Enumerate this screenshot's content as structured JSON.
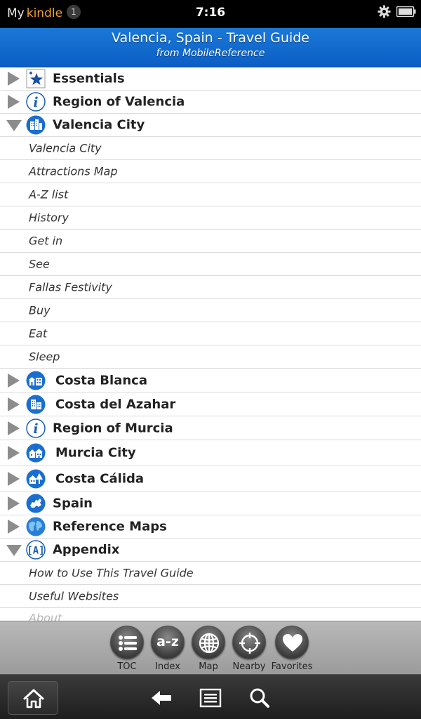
{
  "status_bar": {
    "brand_my": "My",
    "brand_kindle": "kindle",
    "notification_count": "1",
    "clock": "7:16",
    "settings_icon": "gear-icon",
    "battery_icon": "battery-icon"
  },
  "header": {
    "title": "Valencia, Spain - Travel Guide",
    "subtitle": "from MobileReference",
    "color": "#0b5ec4"
  },
  "toc": {
    "sections": [
      {
        "label": "Essentials",
        "icon": "star-icon",
        "expanded": false
      },
      {
        "label": "Region of Valencia",
        "icon": "info-icon",
        "expanded": false
      },
      {
        "label": "Valencia City",
        "icon": "city-icon",
        "expanded": true,
        "items": [
          "Valencia City",
          "Attractions Map",
          "A-Z list",
          "History",
          "Get in",
          "See",
          "Fallas Festivity",
          "Buy",
          "Eat",
          "Sleep"
        ]
      },
      {
        "label": "Costa Blanca",
        "icon": "town-icon",
        "expanded": false
      },
      {
        "label": "Costa del Azahar",
        "icon": "buildings-icon",
        "expanded": false
      },
      {
        "label": "Region of Murcia",
        "icon": "info-icon",
        "expanded": false
      },
      {
        "label": "Murcia City",
        "icon": "houses-icon",
        "expanded": false
      },
      {
        "label": "Costa Cálida",
        "icon": "house-tree-icon",
        "expanded": false
      },
      {
        "label": "Spain",
        "icon": "eu-map-icon",
        "expanded": false
      },
      {
        "label": "Reference Maps",
        "icon": "globe-icon",
        "expanded": false
      },
      {
        "label": "Appendix",
        "icon": "appendix-icon",
        "expanded": true,
        "items": [
          "How to Use This Travel Guide",
          "Useful Websites",
          "About"
        ]
      }
    ]
  },
  "bottom_nav": {
    "buttons": [
      {
        "label": "TOC",
        "icon": "list-icon"
      },
      {
        "label": "Index",
        "icon": "az-icon",
        "glyph": "a-z"
      },
      {
        "label": "Map",
        "icon": "globe-icon"
      },
      {
        "label": "Nearby",
        "icon": "crosshair-icon"
      },
      {
        "label": "Favorites",
        "icon": "heart-icon"
      }
    ]
  },
  "system_bar": {
    "home_icon": "home-icon",
    "back_icon": "back-arrow-icon",
    "menu_icon": "menu-icon",
    "search_icon": "search-icon"
  }
}
